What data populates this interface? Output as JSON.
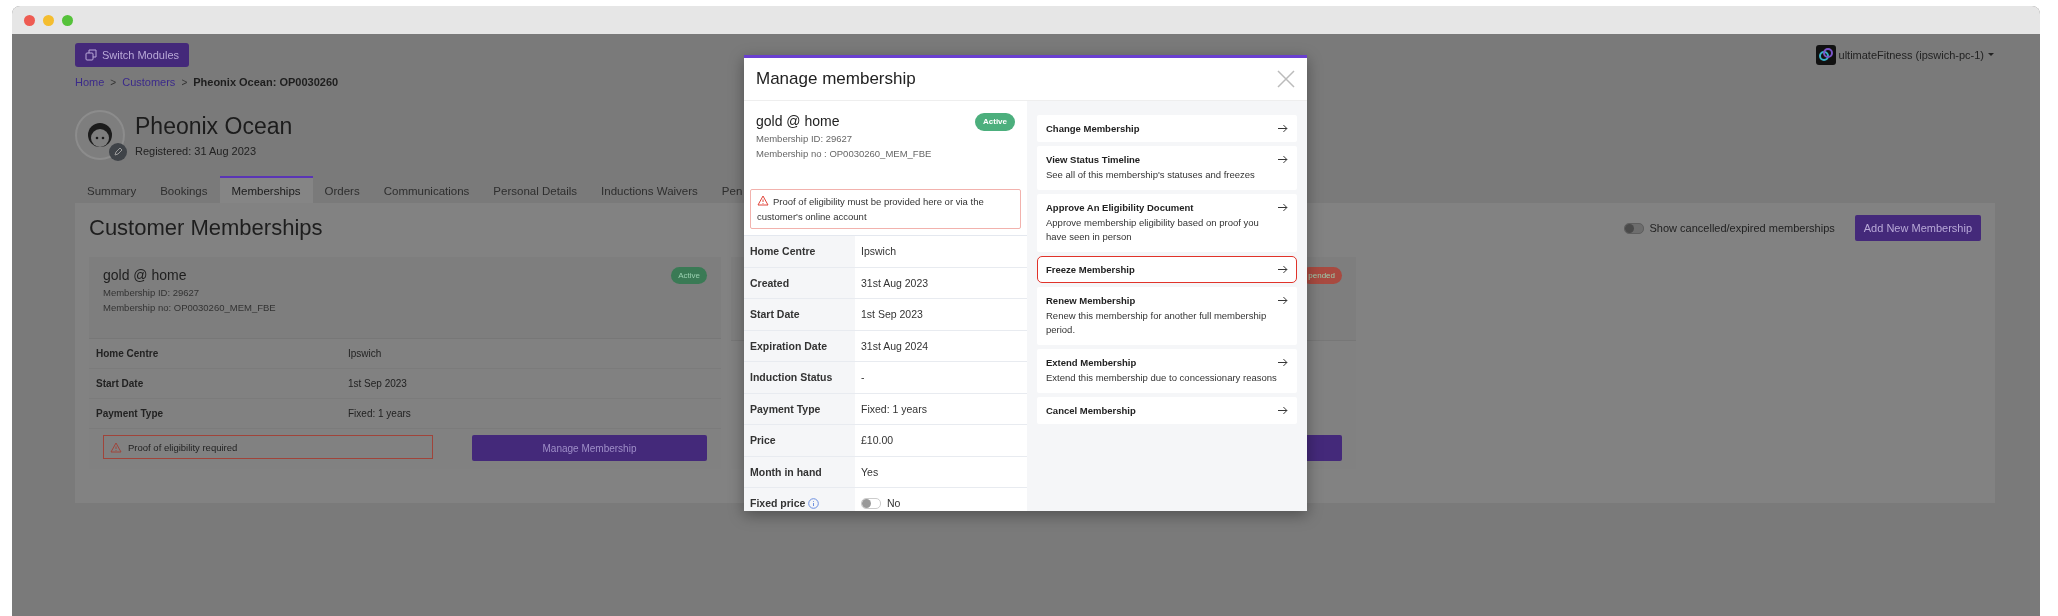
{
  "header": {
    "switch_button": "Switch Modules",
    "account": "ultimateFitness (ipswich-pc-1)"
  },
  "breadcrumb": [
    {
      "label": "Home",
      "link": true
    },
    {
      "separator": ">",
      "label": "Customers",
      "link": true
    },
    {
      "separator": ">",
      "label": "Pheonix Ocean: OP0030260",
      "link": false
    }
  ],
  "customer": {
    "name": "Pheonix Ocean",
    "registered": "Registered: 31 Aug 2023"
  },
  "tabs": [
    {
      "label": "Summary",
      "selected": false
    },
    {
      "label": "Bookings",
      "selected": false
    },
    {
      "label": "Memberships",
      "selected": true
    },
    {
      "label": "Orders",
      "selected": false
    },
    {
      "label": "Communications",
      "selected": false
    },
    {
      "label": "Personal Details",
      "selected": false
    },
    {
      "label": "Inductions Waivers",
      "selected": false
    },
    {
      "label": "Pen",
      "selected": false
    }
  ],
  "page_title": "Customer Memberships",
  "show_cancelled": {
    "label": "Show cancelled/expired memberships",
    "on": false
  },
  "add_button": "Add New Membership",
  "cards": [
    {
      "title": "gold @ home",
      "membership_id": "Membership ID: 29627",
      "membership_no": "Membership no: OP0030260_MEM_FBE",
      "status": {
        "label": "Active",
        "color": "#3a7a55"
      },
      "rows": [
        {
          "label": "Home Centre",
          "value": "Ipswich"
        },
        {
          "label": "Start Date",
          "value": "1st Sep 2023"
        },
        {
          "label": "Payment Type",
          "value": "Fixed: 1 years"
        }
      ],
      "alert": "Proof of eligibility required",
      "button": "Manage Membership"
    },
    {
      "status": {
        "label": "pended",
        "color": "#a84a40"
      }
    }
  ],
  "modal": {
    "title": "Manage membership",
    "membership": {
      "name": "gold @ home",
      "membership_id": "Membership ID: 29627",
      "membership_no": "Membership no : OP0030260_MEM_FBE",
      "status": {
        "label": "Active",
        "color": "#4caf7d"
      }
    },
    "alert": "Proof of eligibility must be provided here or via the customer's online account",
    "details": [
      {
        "kind": "text",
        "label": "Home Centre",
        "value": "Ipswich"
      },
      {
        "kind": "text",
        "label": "Created",
        "value": "31st Aug 2023"
      },
      {
        "kind": "text",
        "label": "Start Date",
        "value": "1st Sep 2023"
      },
      {
        "kind": "text",
        "label": "Expiration Date",
        "value": "31st Aug 2024"
      },
      {
        "kind": "text",
        "label": "Induction Status",
        "value": "-"
      },
      {
        "kind": "text",
        "label": "Payment Type",
        "value": "Fixed: 1 years"
      },
      {
        "kind": "text",
        "label": "Price",
        "value": "£10.00"
      },
      {
        "kind": "text",
        "label": "Month in hand",
        "value": "Yes"
      },
      {
        "kind": "toggle",
        "label": "Fixed price",
        "value": "No",
        "on": false
      }
    ],
    "actions": [
      {
        "title": "Change Membership",
        "highlighted": false
      },
      {
        "title": "View Status Timeline",
        "description": "See all of this membership's statuses and freezes",
        "highlighted": false
      },
      {
        "title": "Approve An Eligibility Document",
        "description": "Approve membership eligibility based on proof you have seen in person",
        "highlighted": false
      },
      {
        "title": "Freeze Membership",
        "highlighted": true
      },
      {
        "title": "Renew Membership",
        "description": "Renew this membership for another full membership period.",
        "highlighted": false
      },
      {
        "title": "Extend Membership",
        "description": "Extend this membership due to concessionary reasons",
        "highlighted": false
      },
      {
        "title": "Cancel Membership",
        "highlighted": false
      }
    ]
  }
}
